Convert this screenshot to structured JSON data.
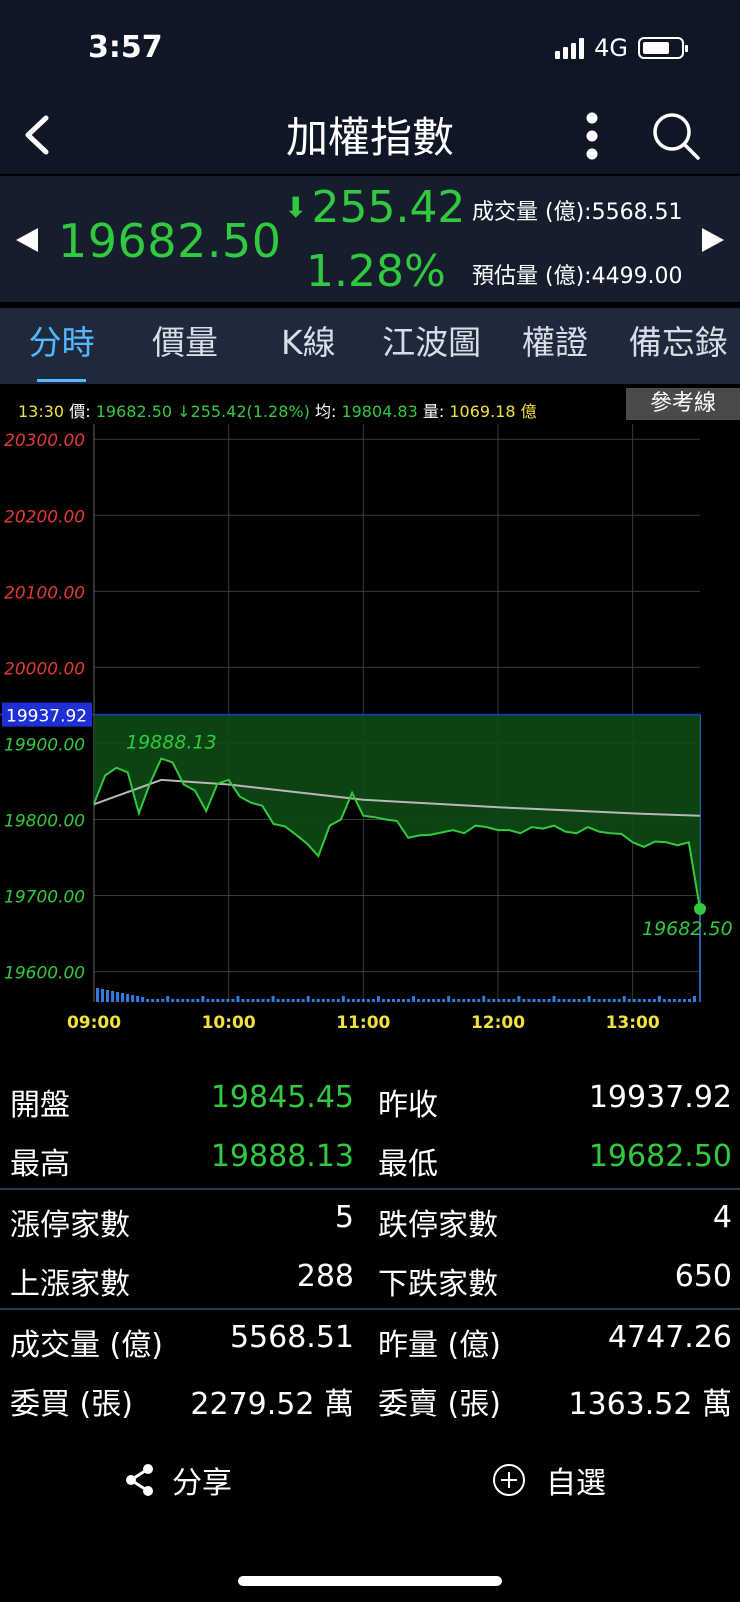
{
  "status": {
    "time": "3:57",
    "network": "4G"
  },
  "nav": {
    "title": "加權指數"
  },
  "quote": {
    "price": "19682.50",
    "change": "255.42",
    "change_pct": "1.28%",
    "volume": "成交量 (億):5568.51",
    "est_volume": "預估量 (億):4499.00"
  },
  "tabs": [
    "分時",
    "價量",
    "K線",
    "江波圖",
    "權證",
    "備忘錄"
  ],
  "info": {
    "time": "13:30",
    "price_label": "價:",
    "price": "19682.50",
    "change": "255.42(1.28%)",
    "avg_label": "均:",
    "avg": "19804.83",
    "vol_label": "量:",
    "vol": "1069.18 億",
    "ref_button": "參考線"
  },
  "chart_data": {
    "type": "line",
    "y_ticks": [
      "20300.00",
      "20200.00",
      "20100.00",
      "20000.00",
      "19900.00",
      "19800.00",
      "19700.00",
      "19600.00"
    ],
    "x_ticks": [
      "09:00",
      "10:00",
      "11:00",
      "12:00",
      "13:00"
    ],
    "ylim": [
      19560,
      20320
    ],
    "reference": {
      "value": 19937.92,
      "label": "19937.92"
    },
    "high_label": "19888.13",
    "last_label": "19682.50",
    "colors": {
      "price": "#31c940",
      "avg": "#b8b8b8",
      "up": "#e23a3a",
      "down": "#31c940",
      "volume": "#2f7de0",
      "ref": "#1e3cd6"
    },
    "series": [
      {
        "values_label": "price",
        "x": [
          "09:00",
          "09:05",
          "09:10",
          "09:15",
          "09:20",
          "09:25",
          "09:30",
          "09:35",
          "09:40",
          "09:45",
          "09:50",
          "09:55",
          "10:00",
          "10:05",
          "10:10",
          "10:15",
          "10:20",
          "10:25",
          "10:30",
          "10:35",
          "10:40",
          "10:45",
          "10:50",
          "10:55",
          "11:00",
          "11:05",
          "11:10",
          "11:15",
          "11:20",
          "11:25",
          "11:30",
          "11:35",
          "11:40",
          "11:45",
          "11:50",
          "11:55",
          "12:00",
          "12:05",
          "12:10",
          "12:15",
          "12:20",
          "12:25",
          "12:30",
          "12:35",
          "12:40",
          "12:45",
          "12:50",
          "12:55",
          "13:00",
          "13:05",
          "13:10",
          "13:15",
          "13:20",
          "13:25",
          "13:30"
        ],
        "values": [
          19821,
          19858,
          19868,
          19862,
          19808,
          19848,
          19880,
          19875,
          19846,
          19838,
          19811,
          19847,
          19852,
          19830,
          19822,
          19818,
          19794,
          19791,
          19780,
          19768,
          19752,
          19792,
          19800,
          19835,
          19805,
          19803,
          19800,
          19798,
          19776,
          19779,
          19780,
          19783,
          19786,
          19782,
          19792,
          19790,
          19786,
          19786,
          19782,
          19790,
          19788,
          19792,
          19784,
          19782,
          19790,
          19784,
          19782,
          19781,
          19770,
          19764,
          19771,
          19770,
          19766,
          19770,
          19682.5
        ]
      },
      {
        "values_label": "avg",
        "x": [
          "09:00",
          "09:30",
          "10:00",
          "10:30",
          "11:00",
          "11:30",
          "12:00",
          "12:30",
          "13:00",
          "13:30"
        ],
        "values": [
          19820,
          19852,
          19846,
          19836,
          19826,
          19821,
          19816,
          19812,
          19808,
          19805
        ]
      }
    ]
  }
}
